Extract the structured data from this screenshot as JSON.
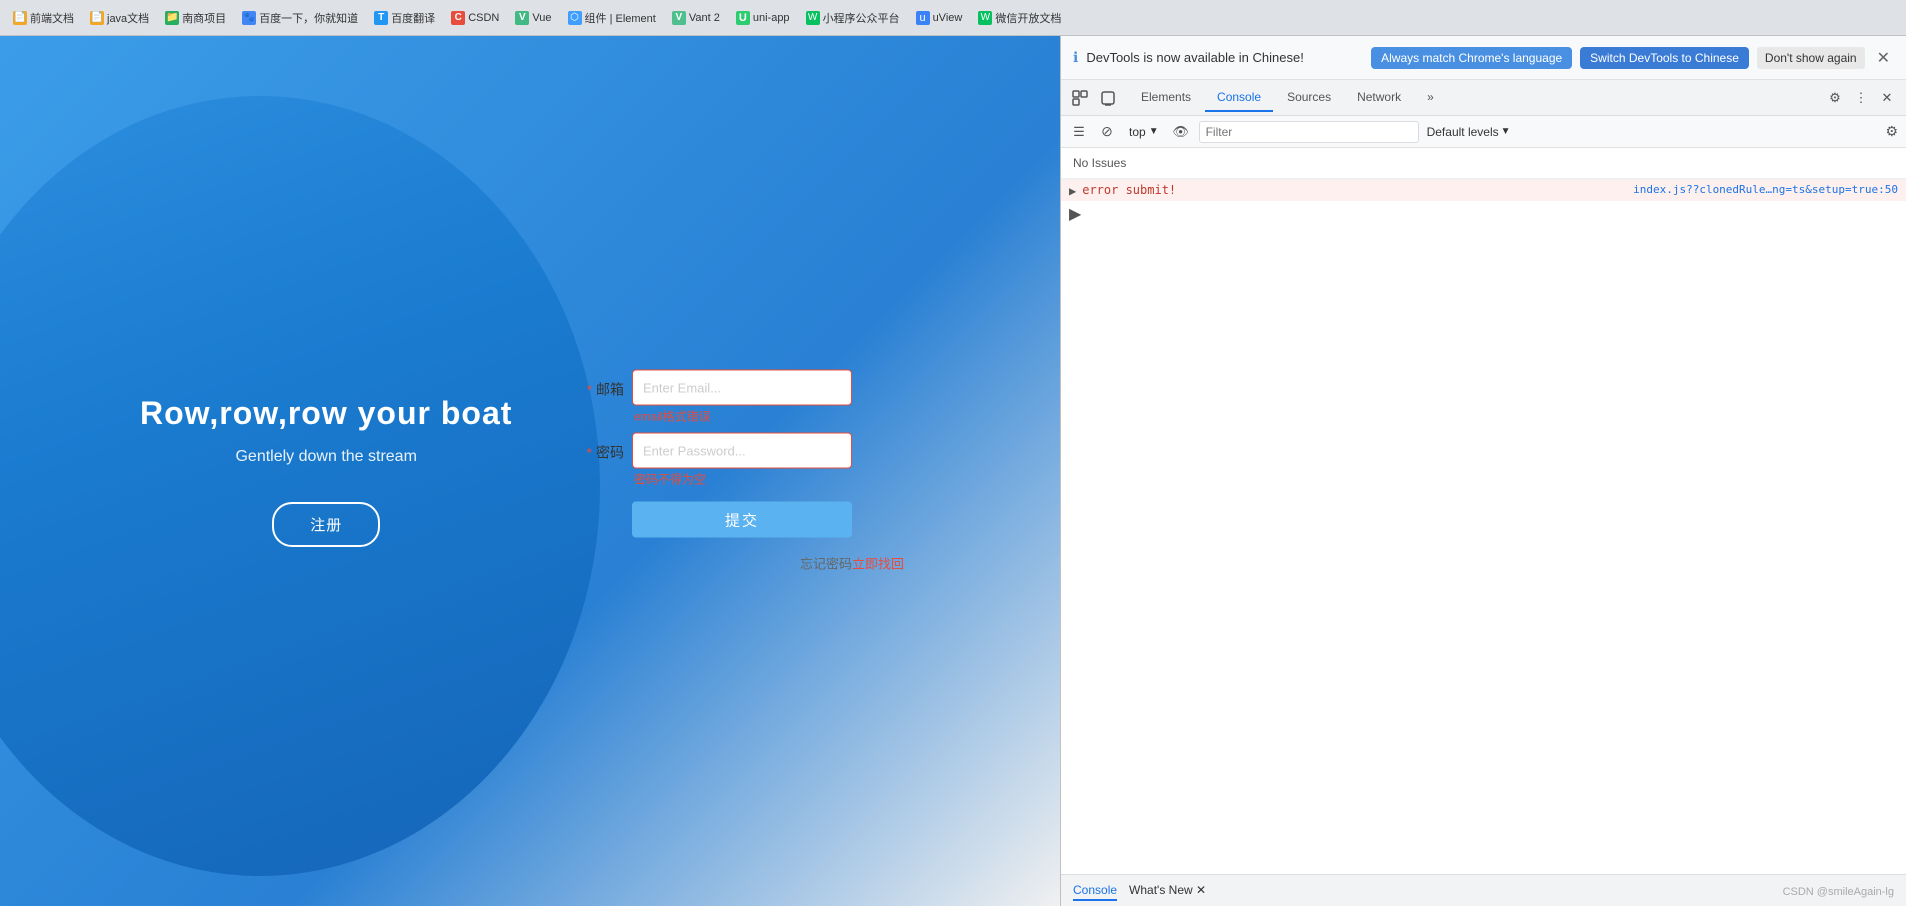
{
  "browser": {
    "bookmarks": [
      {
        "label": "前端文档",
        "icon_color": "#f5a623",
        "icon_char": "📄"
      },
      {
        "label": "java文档",
        "icon_color": "#f5a623",
        "icon_char": "📄"
      },
      {
        "label": "南商项目",
        "icon_color": "#27ae60",
        "icon_char": "📁"
      },
      {
        "label": "百度一下，你就知道",
        "icon_color": "#4285f4",
        "icon_char": "🐾"
      },
      {
        "label": "百度翻译",
        "icon_color": "#2196f3",
        "icon_char": "T"
      },
      {
        "label": "CSDN",
        "icon_color": "#e74c3c",
        "icon_char": "C"
      },
      {
        "label": "Vue",
        "icon_color": "#42b883",
        "icon_char": "V"
      },
      {
        "label": "组件 | Element",
        "icon_color": "#409eff",
        "icon_char": "⬡"
      },
      {
        "label": "Vant 2",
        "icon_color": "#4fc08d",
        "icon_char": "V"
      },
      {
        "label": "uni-app",
        "icon_color": "#2ecc71",
        "icon_char": "U"
      },
      {
        "label": "小程序公众平台",
        "icon_color": "#07c160",
        "icon_char": "W"
      },
      {
        "label": "uView",
        "icon_color": "#3b82f6",
        "icon_char": "u"
      },
      {
        "label": "微信开放文档",
        "icon_color": "#07c160",
        "icon_char": "W"
      }
    ]
  },
  "app": {
    "title": "Row,row,row your boat",
    "subtitle": "Gentlely down the stream",
    "register_btn": "注册"
  },
  "form": {
    "email_label": "邮箱",
    "email_placeholder": "Enter Email...",
    "email_error": "email格式错误",
    "password_label": "密码",
    "password_placeholder": "Enter Password...",
    "password_error": "密码不得为空",
    "submit_btn": "提交",
    "forgot_prefix": "忘记密码",
    "forgot_link": "立即找回",
    "required_mark": "*"
  },
  "devtools": {
    "notify_text": "DevTools is now available in Chinese!",
    "notify_btn1": "Always match Chrome's language",
    "notify_btn2": "Switch DevTools to Chinese",
    "notify_btn3": "Don't show again",
    "tabs": [
      "Elements",
      "Console",
      "Sources",
      "Network",
      "»"
    ],
    "active_tab": "Console",
    "toolbar": {
      "top_label": "top",
      "filter_placeholder": "Filter",
      "default_levels": "Default levels"
    },
    "no_issues": "No Issues",
    "console_log": {
      "text": "error submit!",
      "source": "index.js??clonedRule…ng=ts&setup=true:50"
    },
    "bottom_tabs": [
      "Console",
      "What's New ✕"
    ]
  },
  "watermark": {
    "text": "CSDN @smileAgain-lg"
  }
}
